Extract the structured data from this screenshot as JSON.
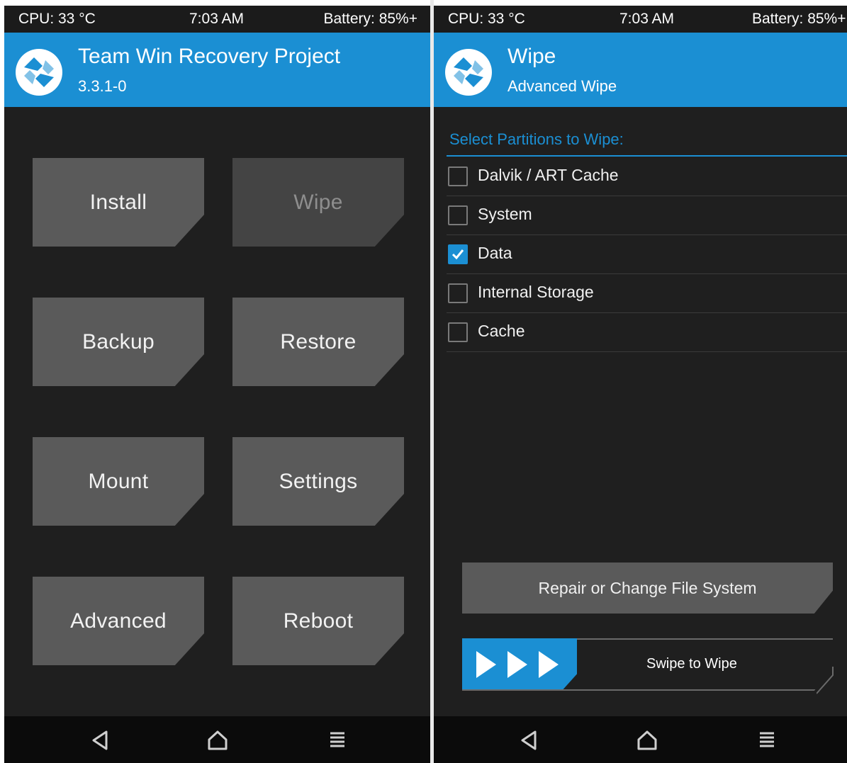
{
  "colors": {
    "accent": "#1b8fd3",
    "background": "#1f1f1f",
    "tile": "#5a5a5a",
    "tile_disabled": "#444444"
  },
  "left": {
    "status": {
      "cpu": "CPU: 33 °C",
      "time": "7:03 AM",
      "battery": "Battery: 85%+"
    },
    "header": {
      "title": "Team Win Recovery Project",
      "subtitle": "3.3.1-0",
      "icon": "twrp-logo-icon"
    },
    "buttons": [
      "Install",
      "Wipe",
      "Backup",
      "Restore",
      "Mount",
      "Settings",
      "Advanced",
      "Reboot"
    ],
    "active_button": "Wipe",
    "nav": [
      "back-icon",
      "home-icon",
      "menu-icon"
    ]
  },
  "right": {
    "status": {
      "cpu": "CPU: 33 °C",
      "time": "7:03 AM",
      "battery": "Battery: 85%+"
    },
    "header": {
      "title": "Wipe",
      "subtitle": "Advanced Wipe",
      "icon": "twrp-logo-icon"
    },
    "section_title": "Select Partitions to Wipe:",
    "partitions": [
      {
        "label": "Dalvik / ART Cache",
        "checked": false
      },
      {
        "label": "System",
        "checked": false
      },
      {
        "label": "Data",
        "checked": true
      },
      {
        "label": "Internal Storage",
        "checked": false
      },
      {
        "label": "Cache",
        "checked": false
      }
    ],
    "repair_label": "Repair or Change File System",
    "swipe_label": "Swipe to Wipe",
    "nav": [
      "back-icon",
      "home-icon",
      "menu-icon"
    ]
  }
}
